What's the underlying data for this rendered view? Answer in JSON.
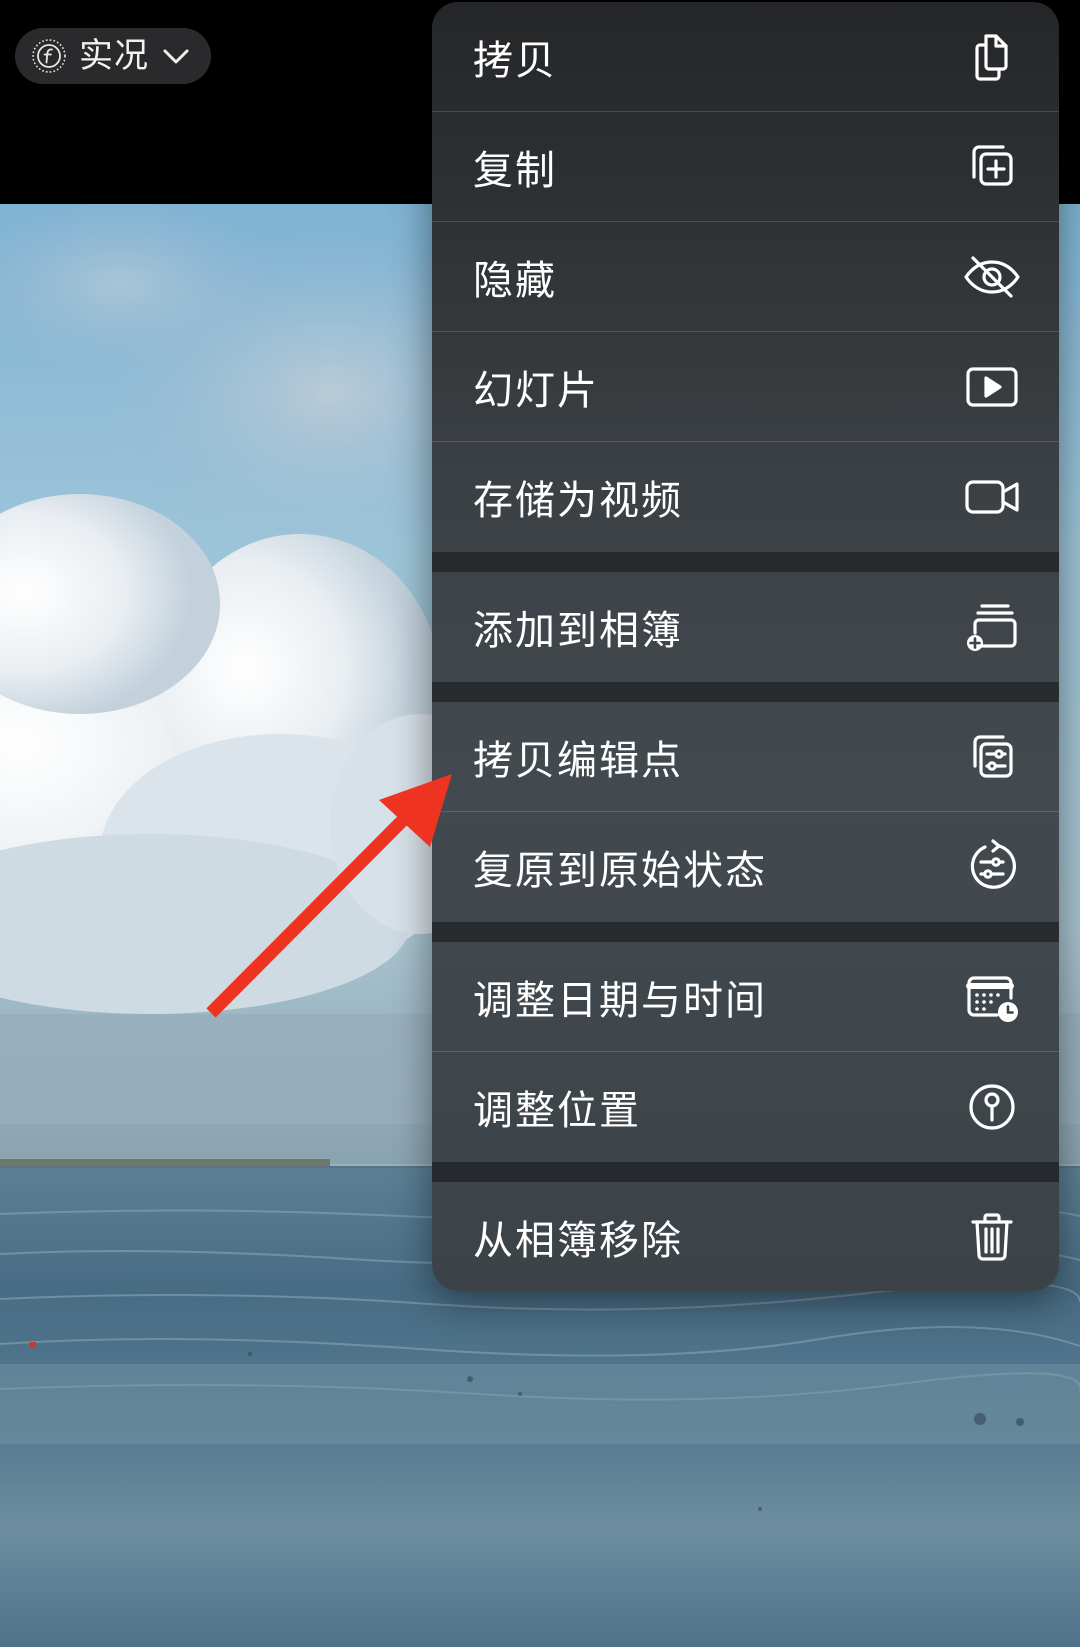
{
  "live_button": {
    "label": "实况",
    "icon": "live-photo-icon",
    "chevron": "chevron-down-icon"
  },
  "menu": {
    "items": [
      {
        "label": "拷贝",
        "icon": "copy-icon"
      },
      {
        "label": "复制",
        "icon": "duplicate-icon"
      },
      {
        "label": "隐藏",
        "icon": "eye-slash-icon"
      },
      {
        "label": "幻灯片",
        "icon": "play-rectangle-icon"
      },
      {
        "label": "存储为视频",
        "icon": "video-camera-icon"
      },
      {
        "label": "添加到相簿",
        "icon": "add-to-album-icon"
      },
      {
        "label": "拷贝编辑点",
        "icon": "copy-edits-icon"
      },
      {
        "label": "复原到原始状态",
        "icon": "revert-icon"
      },
      {
        "label": "调整日期与时间",
        "icon": "calendar-clock-icon"
      },
      {
        "label": "调整位置",
        "icon": "location-pin-icon"
      },
      {
        "label": "从相簿移除",
        "icon": "trash-icon"
      }
    ]
  },
  "annotation": {
    "color": "#ee3320",
    "points_to": "拷贝编辑点"
  }
}
